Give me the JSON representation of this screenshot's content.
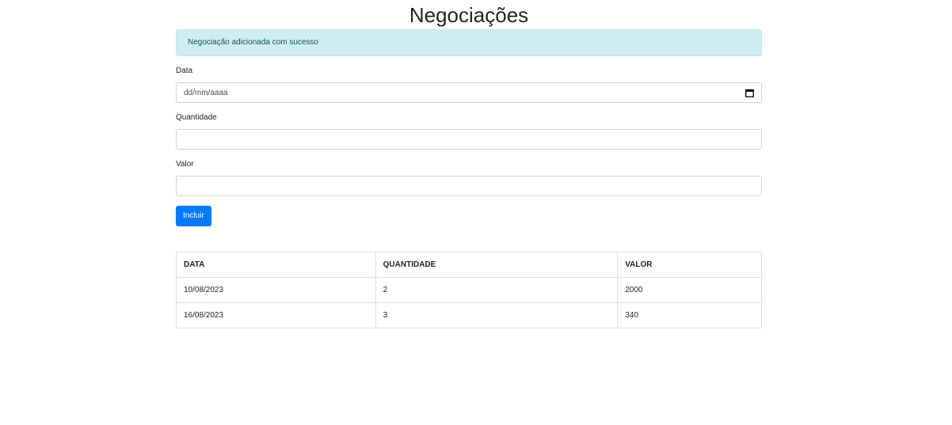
{
  "page": {
    "title": "Negociações"
  },
  "alert": {
    "message": "Negociação adicionada com sucesso"
  },
  "form": {
    "date_label": "Data",
    "date_placeholder": "dd/mm/aaaa",
    "quantity_label": "Quantidade",
    "quantity_value": "",
    "value_label": "Valor",
    "value_value": "",
    "submit_label": "Incluir",
    "calendar_icon": "calendar-icon"
  },
  "table": {
    "headers": [
      "DATA",
      "QUANTIDADE",
      "VALOR"
    ],
    "rows": [
      [
        "10/08/2023",
        "2",
        "2000"
      ],
      [
        "16/08/2023",
        "3",
        "340"
      ]
    ]
  },
  "colors": {
    "primary": "#007bff",
    "alert_bg": "#d1ecf1",
    "alert_text": "#0c5460"
  }
}
